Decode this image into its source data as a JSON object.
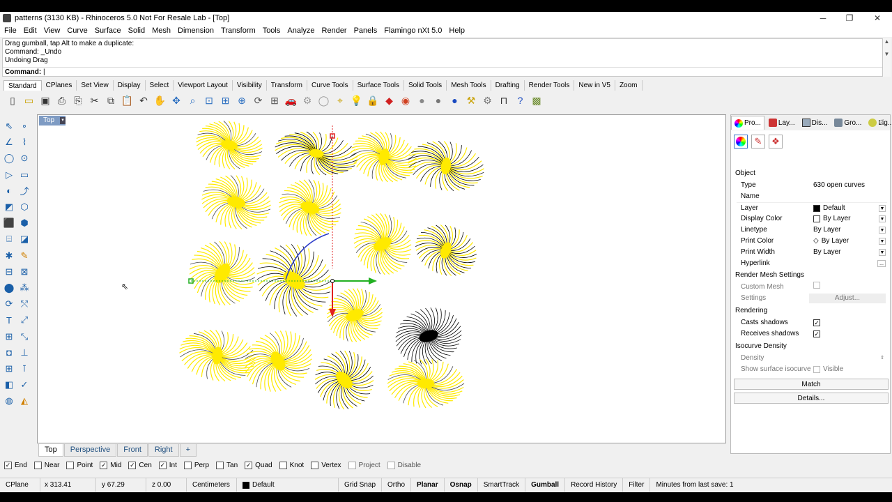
{
  "window": {
    "title": "patterns (3130 KB) - Rhinoceros 5.0 Not For Resale Lab - [Top]",
    "controls": {
      "minimize": "─",
      "restore": "❐",
      "close": "✕"
    }
  },
  "menu": [
    "File",
    "Edit",
    "View",
    "Curve",
    "Surface",
    "Solid",
    "Mesh",
    "Dimension",
    "Transform",
    "Tools",
    "Analyze",
    "Render",
    "Panels",
    "Flamingo nXt 5.0",
    "Help"
  ],
  "command_history": [
    "Drag gumball, tap Alt to make a duplicate:",
    "Command: _Undo",
    "Undoing Drag"
  ],
  "command_prompt": "Command:",
  "toolbar_tabs": [
    "Standard",
    "CPlanes",
    "Set View",
    "Display",
    "Select",
    "Viewport Layout",
    "Visibility",
    "Transform",
    "Curve Tools",
    "Surface Tools",
    "Solid Tools",
    "Mesh Tools",
    "Drafting",
    "Render Tools",
    "New in V5",
    "Zoom"
  ],
  "toolbar_icons": [
    {
      "name": "new-icon",
      "glyph": "▯"
    },
    {
      "name": "open-icon",
      "glyph": "▭"
    },
    {
      "name": "save-icon",
      "glyph": "▣"
    },
    {
      "name": "print-icon",
      "glyph": "⎙"
    },
    {
      "name": "export-icon",
      "glyph": "⎘"
    },
    {
      "name": "cut-icon",
      "glyph": "✂"
    },
    {
      "name": "copy-icon",
      "glyph": "⧉"
    },
    {
      "name": "paste-icon",
      "glyph": "📋"
    },
    {
      "name": "undo-icon",
      "glyph": "↶"
    },
    {
      "name": "pan-icon",
      "glyph": "✋"
    },
    {
      "name": "move-view-icon",
      "glyph": "✥"
    },
    {
      "name": "zoom-icon",
      "glyph": "⌕"
    },
    {
      "name": "zoom-window-icon",
      "glyph": "⊡"
    },
    {
      "name": "zoom-extents-icon",
      "glyph": "⊞"
    },
    {
      "name": "zoom-selected-icon",
      "glyph": "⊕"
    },
    {
      "name": "rotate-view-icon",
      "glyph": "⟳"
    },
    {
      "name": "four-view-icon",
      "glyph": "⊞"
    },
    {
      "name": "car-icon",
      "glyph": "🚗"
    },
    {
      "name": "gear-icon",
      "glyph": "⚙"
    },
    {
      "name": "circle-icon",
      "glyph": "◯"
    },
    {
      "name": "snap-icon",
      "glyph": "⌖"
    },
    {
      "name": "light-icon",
      "glyph": "💡"
    },
    {
      "name": "lock-icon",
      "glyph": "🔒"
    },
    {
      "name": "material-icon",
      "glyph": "◆"
    },
    {
      "name": "color-wheel-icon",
      "glyph": "◉"
    },
    {
      "name": "sphere-gray-icon",
      "glyph": "●"
    },
    {
      "name": "sphere-shaded-icon",
      "glyph": "●"
    },
    {
      "name": "sphere-blue-icon",
      "glyph": "●"
    },
    {
      "name": "brush-icon",
      "glyph": "⚒"
    },
    {
      "name": "settings-icon",
      "glyph": "⚙"
    },
    {
      "name": "dimension-icon",
      "glyph": "⊓"
    },
    {
      "name": "help-icon",
      "glyph": "?"
    },
    {
      "name": "texture-icon",
      "glyph": "▩"
    }
  ],
  "viewport": {
    "title": "Top",
    "dropdown": "▾"
  },
  "gumball_colors": {
    "x": "#22b022",
    "y": "#e02020",
    "z": "#2a3ac8"
  },
  "curve_colors": {
    "yellow": "#ffea00",
    "black": "#000000"
  },
  "viewport_tabs": [
    "Top",
    "Perspective",
    "Front",
    "Right",
    "+"
  ],
  "osnaps": [
    {
      "label": "End",
      "checked": true
    },
    {
      "label": "Near",
      "checked": false
    },
    {
      "label": "Point",
      "checked": false
    },
    {
      "label": "Mid",
      "checked": true
    },
    {
      "label": "Cen",
      "checked": true
    },
    {
      "label": "Int",
      "checked": true
    },
    {
      "label": "Perp",
      "checked": false
    },
    {
      "label": "Tan",
      "checked": false
    },
    {
      "label": "Quad",
      "checked": true
    },
    {
      "label": "Knot",
      "checked": false
    },
    {
      "label": "Vertex",
      "checked": false
    },
    {
      "label": "Project",
      "checked": false,
      "disabled": true
    },
    {
      "label": "Disable",
      "checked": false,
      "disabled": true
    }
  ],
  "status": {
    "cplane": "CPlane",
    "x": "x 313.41",
    "y": "y 67.29",
    "z": "z 0.00",
    "units": "Centimeters",
    "layer": "Default",
    "grid_snap": "Grid Snap",
    "ortho": "Ortho",
    "planar": "Planar",
    "osnap": "Osnap",
    "smarttrack": "SmartTrack",
    "gumball": "Gumball",
    "record_history": "Record History",
    "filter": "Filter",
    "last_save": "Minutes from last save: 1"
  },
  "panel": {
    "tabs": [
      "Pro...",
      "Lay...",
      "Dis...",
      "Gro...",
      "Lig..."
    ],
    "tab_icons": [
      "properties-icon",
      "layers-icon",
      "display-icon",
      "groups-icon",
      "lights-icon"
    ],
    "sections": {
      "object": "Object",
      "render_mesh": "Render Mesh Settings",
      "rendering": "Rendering",
      "isocurve": "Isocurve Density"
    },
    "rows": {
      "type": {
        "k": "Type",
        "v": "630 open curves"
      },
      "name": {
        "k": "Name",
        "v": ""
      },
      "layer": {
        "k": "Layer",
        "v": "Default"
      },
      "display_color": {
        "k": "Display Color",
        "v": "By Layer"
      },
      "linetype": {
        "k": "Linetype",
        "v": "By Layer"
      },
      "print_color": {
        "k": "Print Color",
        "v": "By Layer"
      },
      "print_width": {
        "k": "Print Width",
        "v": "By Layer"
      },
      "hyperlink": {
        "k": "Hyperlink",
        "v": "..."
      },
      "custom_mesh": {
        "k": "Custom Mesh",
        "v": ""
      },
      "settings": {
        "k": "Settings",
        "v": "Adjust..."
      },
      "casts_shadows": {
        "k": "Casts shadows",
        "v": "✓"
      },
      "receives_shadows": {
        "k": "Receives shadows",
        "v": "✓"
      },
      "density": {
        "k": "Density",
        "v": ""
      },
      "show_surface_isocurve": {
        "k": "Show surface isocurve",
        "v": "Visible"
      }
    },
    "buttons": {
      "match": "Match",
      "details": "Details..."
    }
  }
}
